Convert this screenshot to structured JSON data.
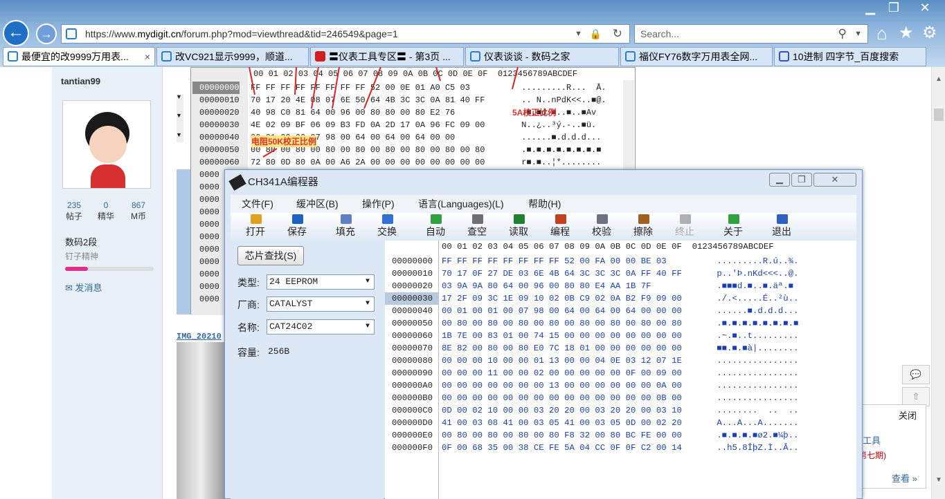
{
  "browser": {
    "url_prefix": "https://www.",
    "url_domain": "mydigit.cn",
    "url_path": "/forum.php?mod=viewthread&tid=246549&page=1",
    "search_placeholder": "Search...",
    "tabs": [
      {
        "label": "最便宜的改9999万用表..."
      },
      {
        "label": "改VC921显示9999，顺道..."
      },
      {
        "label": "〓仪表工具专区〓 - 第3页 ..."
      },
      {
        "label": "仪表谈谈 - 数码之家"
      },
      {
        "label": "福仪FY76数字万用表全网..."
      },
      {
        "label": "10进制 四字节_百度搜索"
      }
    ],
    "close_tab": "×"
  },
  "forum": {
    "username": "tantian99",
    "stats": [
      {
        "value": "235",
        "label": "帖子"
      },
      {
        "value": "0",
        "label": "精华"
      },
      {
        "value": "867",
        "label": "M币"
      }
    ],
    "rank": "数码2段",
    "rank_title": "钉子精神",
    "send_message": "发消息",
    "image_link": "IMG_20210",
    "right_close": "关闭",
    "right_line1": "工具",
    "right_line2": "第七期)",
    "right_more": "查看 »",
    "annotation_5a": "5A校正比例",
    "annotation_50k": "电阻50K校正比例"
  },
  "hex_top": {
    "header": "00 01 02 03 04 05 06 07 08 09 0A 0B 0C 0D 0E 0F  0123456789ABCDEF",
    "rows": [
      {
        "addr": "00000000",
        "bytes": "FF FF FF FF FF FF FF FF 52 00 0E 01 A0 C5 03",
        "ascii": " .........R...  Å."
      },
      {
        "addr": "00000010",
        "bytes": "70 17 20 4E 08 07 6E 50 64 4B 3C 3C 0A 81 40 FF",
        "ascii": " .. N..nPdK<<..■@."
      },
      {
        "addr": "00000020",
        "bytes": "40 98 C0 81 64 00 96 00 80 80 00 80 E2 76",
        "ascii": " .■.■d.■..■..■Av"
      },
      {
        "addr": "00000030",
        "bytes": "4E 02 09 BF 06 09 B3 FD 0A 2D 17 0A 96 FC 09 00",
        "ascii": " N..¿..³ý.-..■ü."
      },
      {
        "addr": "00000040",
        "bytes": "00 01 00 00 07 98 00 64 00 64 00 64 00 00",
        "ascii": " ......■.d.d.d..."
      },
      {
        "addr": "00000050",
        "bytes": "00 80 00 80 00 80 00 80 00 80 00 80 00 80 00 80",
        "ascii": " .■.■.■.■.■.■.■.■"
      },
      {
        "addr": "00000060",
        "bytes": "72 80 0D 80 0A 00 A6 2A 00 00 00 00 00 00 00 00",
        "ascii": " r■.■..¦*........"
      },
      {
        "addr": "0000",
        "bytes": "",
        "ascii": ""
      },
      {
        "addr": "0000",
        "bytes": "",
        "ascii": ""
      },
      {
        "addr": "0000",
        "bytes": "",
        "ascii": ""
      },
      {
        "addr": "0000",
        "bytes": "",
        "ascii": ""
      },
      {
        "addr": "0000",
        "bytes": "",
        "ascii": ""
      },
      {
        "addr": "0000",
        "bytes": "",
        "ascii": ""
      },
      {
        "addr": "0000",
        "bytes": "",
        "ascii": ""
      },
      {
        "addr": "0000",
        "bytes": "",
        "ascii": ""
      },
      {
        "addr": "0000",
        "bytes": "",
        "ascii": ""
      },
      {
        "addr": "0000",
        "bytes": "",
        "ascii": ""
      },
      {
        "addr": "0000",
        "bytes": "",
        "ascii": ""
      }
    ]
  },
  "app": {
    "title": "CH341A编程器",
    "menu": [
      "文件(F)",
      "缓冲区(B)",
      "操作(P)",
      "语言(Languages)(L)",
      "帮助(H)"
    ],
    "toolbar": [
      {
        "label": "打开",
        "icon": "open-folder-icon",
        "color": "#e0a020"
      },
      {
        "label": "保存",
        "icon": "save-icon",
        "color": "#2060c0"
      },
      {
        "label": "填充",
        "icon": "fill-icon",
        "color": "#6080c0"
      },
      {
        "label": "交换",
        "icon": "swap-icon",
        "color": "#3070d0"
      },
      {
        "label": "自动",
        "icon": "auto-icon",
        "color": "#30a040"
      },
      {
        "label": "查空",
        "icon": "blank-check-icon",
        "color": "#707070"
      },
      {
        "label": "读取",
        "icon": "read-icon",
        "color": "#208030"
      },
      {
        "label": "编程",
        "icon": "program-icon",
        "color": "#c04020"
      },
      {
        "label": "校验",
        "icon": "verify-icon",
        "color": "#707080"
      },
      {
        "label": "擦除",
        "icon": "erase-icon",
        "color": "#a06020"
      },
      {
        "label": "终止",
        "icon": "stop-icon",
        "color": "#b0b0b0"
      },
      {
        "label": "关于",
        "icon": "info-icon",
        "color": "#30a040"
      },
      {
        "label": "退出",
        "icon": "exit-icon",
        "color": "#3060c0"
      }
    ],
    "chip_search": "芯片查找(S)",
    "type_label": "类型:",
    "type_value": "24 EEPROM",
    "vendor_label": "厂商:",
    "vendor_value": "CATALYST",
    "name_label": "名称:",
    "name_value": "CAT24C02",
    "capacity_label": "容量:",
    "capacity_value": "256B",
    "hex_header": "00 01 02 03 04 05 06 07 08 09 0A 0B 0C 0D 0E 0F  0123456789ABCDEF",
    "hex_rows": [
      {
        "addr": "00000000",
        "bytes": "FF FF FF FF FF FF FF FF 52 00 FA 00 00 BE 03",
        "ascii": " .........R.ú..¾."
      },
      {
        "addr": "00000010",
        "bytes": "70 17 0F 27 DE 03 6E 4B 64 3C 3C 3C 0A FF 40 FF",
        "ascii": " p..'Þ.nKd<<<..@."
      },
      {
        "addr": "00000020",
        "bytes": "03 9A 9A 80 64 00 96 00 80 80 E4 AA 1B 7F",
        "ascii": " .■■■d.■..■.äª.■"
      },
      {
        "addr": "00000030",
        "bytes": "17 2F 09 3C 1E 09 10 02 0B C9 02 0A B2 F9 09 00",
        "ascii": " ./.<.....É..²ù.."
      },
      {
        "addr": "00000040",
        "bytes": "00 01 00 01 00 07 98 00 64 00 64 00 64 00 00 00",
        "ascii": " ......■.d.d.d..."
      },
      {
        "addr": "00000050",
        "bytes": "00 80 00 80 00 80 00 80 00 80 00 80 00 80 00 80",
        "ascii": " .■.■.■.■.■.■.■.■"
      },
      {
        "addr": "00000060",
        "bytes": "1B 7E 00 83 01 00 74 15 00 00 00 00 00 00 00 00",
        "ascii": " .~.■..t........."
      },
      {
        "addr": "00000070",
        "bytes": "8E 82 00 80 00 80 E0 7C 18 01 00 00 00 00 00 00",
        "ascii": " ■■.■.■à|........"
      },
      {
        "addr": "00000080",
        "bytes": "00 00 00 10 00 00 01 13 00 00 04 0E 03 12 07 1E",
        "ascii": " ................"
      },
      {
        "addr": "00000090",
        "bytes": "00 00 00 11 00 00 02 00 00 00 00 00 0F 00 09 00",
        "ascii": " ................"
      },
      {
        "addr": "000000A0",
        "bytes": "00 00 00 00 00 00 00 13 00 00 00 00 00 00 0A 00",
        "ascii": " ................"
      },
      {
        "addr": "000000B0",
        "bytes": "00 00 00 00 00 00 00 00 00 00 00 00 00 00 0B 00",
        "ascii": " ................"
      },
      {
        "addr": "000000C0",
        "bytes": "0D 00 02 10 00 00 03 20 20 00 03 20 20 00 03 10",
        "ascii": " ........  ..  .."
      },
      {
        "addr": "000000D0",
        "bytes": "41 00 03 08 41 00 03 05 41 00 03 05 0D 00 02 20",
        "ascii": " A...A...A......."
      },
      {
        "addr": "000000E0",
        "bytes": "00 80 00 80 00 80 00 80 F8 32 00 80 BC FE 00 00",
        "ascii": " .■.■.■.■ø2.■¼þ.."
      },
      {
        "addr": "000000F0",
        "bytes": "0F 00 68 35 00 38 CE FE 5A 04 CC 0F 0F C2 00 14",
        "ascii": " ..h5.8ÎþZ.Ì..Â.."
      }
    ]
  }
}
